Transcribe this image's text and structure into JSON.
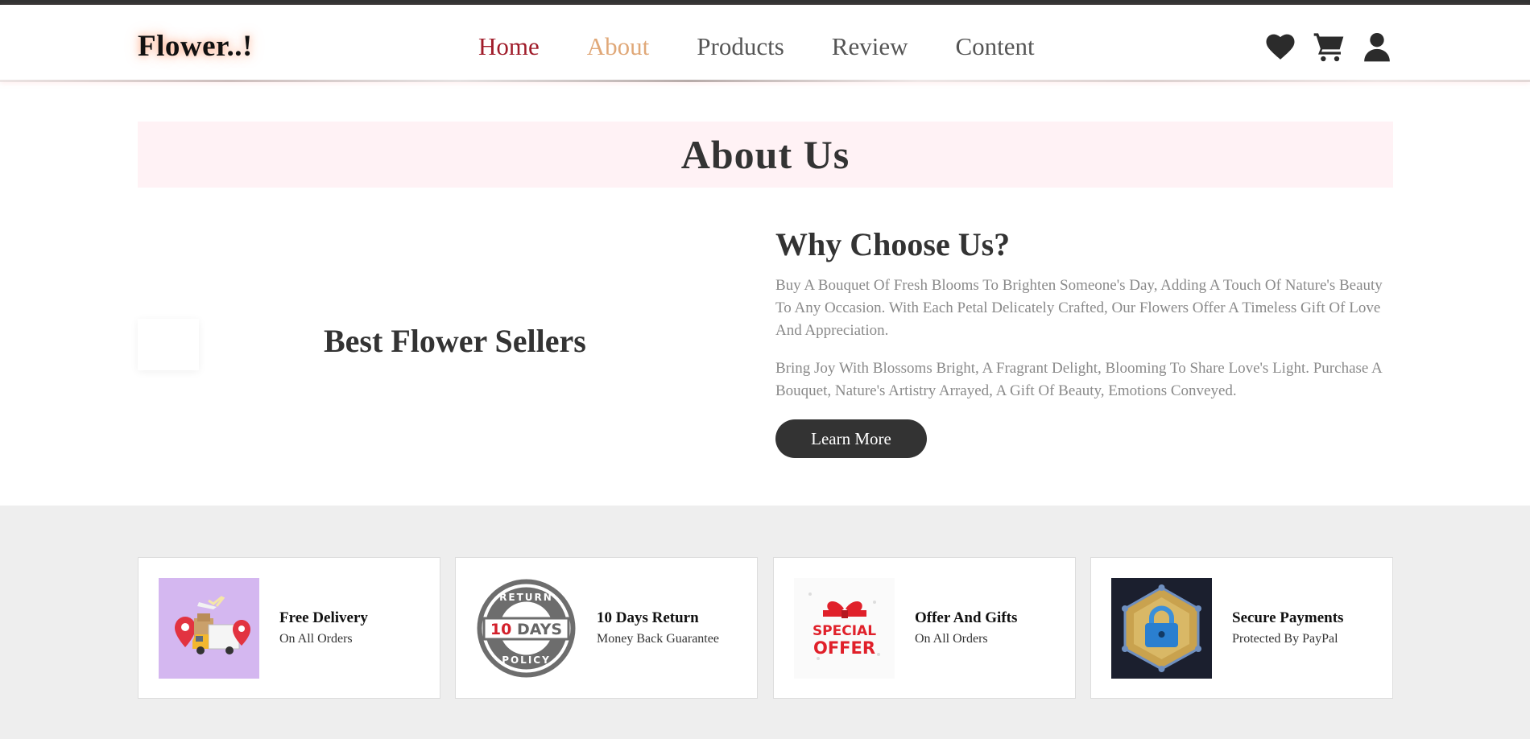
{
  "header": {
    "logo": "Flower..!",
    "nav": [
      {
        "label": "Home",
        "color": "#a01c2a"
      },
      {
        "label": "About",
        "color": "#e0a878"
      },
      {
        "label": "Products"
      },
      {
        "label": "Review"
      },
      {
        "label": "Content"
      }
    ],
    "icons": [
      "heart-icon",
      "cart-icon",
      "user-icon"
    ]
  },
  "about": {
    "banner_title": "About Us",
    "left_title": "Best Flower Sellers",
    "why_title": "Why Choose Us?",
    "paragraph1": "Buy A Bouquet Of Fresh Blooms To Brighten Someone's Day, Adding A Touch Of Nature's Beauty To Any Occasion. With Each Petal Delicately Crafted, Our Flowers Offer A Timeless Gift Of Love And Appreciation.",
    "paragraph2": "Bring Joy With Blossoms Bright, A Fragrant Delight, Blooming To Share Love's Light. Purchase A Bouquet, Nature's Artistry Arrayed, A Gift Of Beauty, Emotions Conveyed.",
    "button_label": "Learn More"
  },
  "features": [
    {
      "title": "Free Delivery",
      "subtitle": "On All Orders",
      "icon": "delivery-truck-image"
    },
    {
      "title": "10 Days Return",
      "subtitle": "Money Back Guarantee",
      "icon": "return-policy-badge-image",
      "badge_top": "RETURN",
      "badge_mid": "10 DAYS",
      "badge_bottom": "POLICY"
    },
    {
      "title": "Offer And Gifts",
      "subtitle": "On All Orders",
      "icon": "special-offer-gift-image",
      "offer_line1": "SPECIAL",
      "offer_line2": "OFFER"
    },
    {
      "title": "Secure Payments",
      "subtitle": "Protected By PayPal",
      "icon": "secure-lock-image"
    }
  ],
  "colors": {
    "accent_dark": "#333333",
    "banner_bg": "#fff2f5",
    "features_bg": "#eeeeee",
    "offer_red": "#e0202a"
  }
}
